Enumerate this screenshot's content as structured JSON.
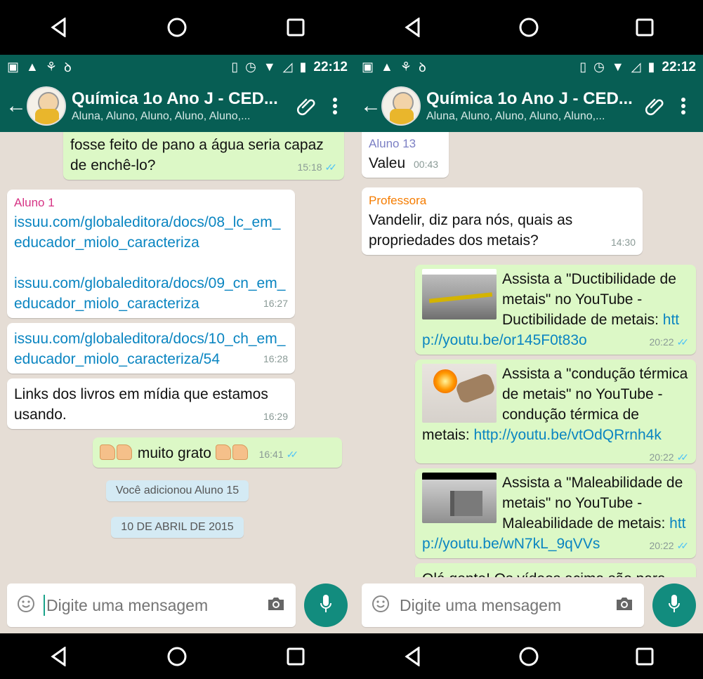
{
  "status": {
    "time": "22:12"
  },
  "header": {
    "title": "Química 1o Ano J - CED...",
    "subtitle": "Aluna, Aluno, Aluno, Aluno, Aluno,..."
  },
  "left_chat": {
    "m1": {
      "text": "fosse feito de pano a água seria capaz de enchê-lo?",
      "time": "15:18"
    },
    "m2": {
      "sender": "Aluno 1",
      "link1": "issuu.com/globaleditora/docs/08_lc_em_educador_miolo_caracteriza",
      "link2": "issuu.com/globaleditora/docs/09_cn_em_educador_miolo_caracteriza",
      "time": "16:27"
    },
    "m3": {
      "link": "issuu.com/globaleditora/docs/10_ch_em_educador_miolo_caracteriza/54",
      "time": "16:28"
    },
    "m4": {
      "text": "Links dos livros em mídia que estamos usando.",
      "time": "16:29"
    },
    "m5": {
      "text": "muito grato",
      "time": "16:41"
    },
    "sys1": "Você adicionou Aluno 15",
    "sys2": "10 DE ABRIL DE 2015"
  },
  "right_chat": {
    "m1": {
      "sender": "Aluno 13",
      "text": "Valeu",
      "time": "00:43"
    },
    "m2": {
      "sender": "Professora",
      "text": "Vandelir, diz para nós, quais as propriedades dos metais?",
      "time": "14:30"
    },
    "m3": {
      "text": "Assista a \"Ductibilidade de metais\" no YouTube - Ductibilidade de metais:",
      "link": "http://youtu.be/or145F0t83o",
      "time": "20:22"
    },
    "m4": {
      "text": "Assista a \"condução térmica de metais\" no YouTube - condução térmica de metais:",
      "link": "http://youtu.be/vtOdQRrnh4k",
      "time": "20:22"
    },
    "m5": {
      "text": "Assista a \"Maleabilidade de metais\" no YouTube - Maleabilidade de metais:",
      "link": "http://youtu.be/wN7kL_9qVVs",
      "time": "20:22"
    },
    "m6": {
      "text": "Olá gente! Os vídeos acima são para ajudar a entender algumas das"
    }
  },
  "composer": {
    "placeholder": "Digite uma mensagem"
  },
  "colors": {
    "header": "#075e54",
    "outgoing": "#dcf8c6",
    "mic": "#128c7e",
    "link": "#0a85c1",
    "aluno1": "#d63384",
    "aluno13": "#7b7fc4",
    "professora": "#f57c00"
  },
  "icons": [
    "back-arrow-icon",
    "paperclip-icon",
    "more-vert-icon",
    "emoji-icon",
    "camera-icon",
    "mic-icon",
    "nav-back-icon",
    "nav-home-icon",
    "nav-recents-icon"
  ]
}
